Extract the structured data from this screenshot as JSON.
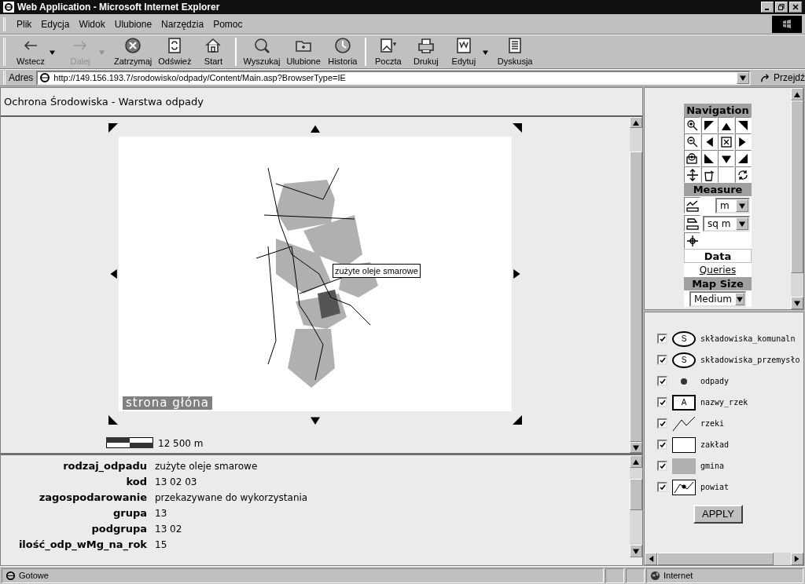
{
  "window": {
    "title": "Web Application - Microsoft Internet Explorer"
  },
  "menu": [
    {
      "label": "Plik"
    },
    {
      "label": "Edycja"
    },
    {
      "label": "Widok"
    },
    {
      "label": "Ulubione"
    },
    {
      "label": "Narzędzia"
    },
    {
      "label": "Pomoc"
    }
  ],
  "toolbar": [
    {
      "kind": "back",
      "label": "Wstecz",
      "disabled": false,
      "dropdown": true
    },
    {
      "kind": "forward",
      "label": "Dalej",
      "disabled": true,
      "dropdown": true
    },
    {
      "kind": "stop",
      "label": "Zatrzymaj",
      "disabled": false,
      "dropdown": false
    },
    {
      "kind": "refresh",
      "label": "Odśwież",
      "disabled": false,
      "dropdown": false
    },
    {
      "kind": "home",
      "label": "Start",
      "disabled": false,
      "dropdown": false
    },
    {
      "kind": "search",
      "label": "Wyszukaj",
      "disabled": false,
      "dropdown": false
    },
    {
      "kind": "favorites",
      "label": "Ulubione",
      "disabled": false,
      "dropdown": false
    },
    {
      "kind": "history",
      "label": "Historia",
      "disabled": false,
      "dropdown": false
    },
    {
      "kind": "mail",
      "label": "Poczta",
      "disabled": false,
      "dropdown": false
    },
    {
      "kind": "print",
      "label": "Drukuj",
      "disabled": false,
      "dropdown": false
    },
    {
      "kind": "edit",
      "label": "Edytuj",
      "disabled": false,
      "dropdown": true
    },
    {
      "kind": "discuss",
      "label": "Dyskusja",
      "disabled": false,
      "dropdown": false
    }
  ],
  "address": {
    "label": "Adres",
    "value": "http://149.156.193.7/srodowisko/odpady/Content/Main.asp?BrowserType=IE",
    "go": "Przejdź"
  },
  "page_title": "Ochrona Środowiska - Warstwa odpady",
  "map": {
    "kind": "picture",
    "tooltip": "zużyte oleje smarowe",
    "home_link": "strona głóna",
    "scale": "12 500 m"
  },
  "attributes": [
    {
      "name": "rodzaj_odpadu",
      "value": "zużyte oleje smarowe"
    },
    {
      "name": "kod",
      "value": "13 02 03"
    },
    {
      "name": "zagospodarowanie",
      "value": "przekazywane do wykorzystania"
    },
    {
      "name": "grupa",
      "value": "13"
    },
    {
      "name": "podgrupa",
      "value": "13 02"
    },
    {
      "name": "ilość_odp_wMg_na_rok",
      "value": "15"
    }
  ],
  "tools": {
    "navigation": "Navigation",
    "measure": "Measure",
    "distance_unit": "m",
    "area_unit": "sq m",
    "data": "Data",
    "queries": "Queries",
    "map_size": "Map Size",
    "size": "Medium"
  },
  "legend": [
    {
      "kind": "oval",
      "symbol": "S",
      "label": "składowiska_komunaln",
      "checked": true
    },
    {
      "kind": "oval",
      "symbol": "S",
      "label": "składowiska_przemysło",
      "checked": true
    },
    {
      "kind": "dot",
      "label": "odpady",
      "checked": true
    },
    {
      "kind": "text_box",
      "symbol": "A",
      "label": "nazwy_rzek",
      "checked": true
    },
    {
      "kind": "line",
      "label": "rzeki",
      "checked": true
    },
    {
      "kind": "empty_fill",
      "label": "zakład",
      "checked": true
    },
    {
      "kind": "grey_fill",
      "label": "gmina",
      "checked": true
    },
    {
      "kind": "boundary",
      "label": "powiat",
      "checked": true
    }
  ],
  "apply": "APPLY",
  "status_bar": {
    "text": "Gotowe",
    "zone": "Internet"
  }
}
